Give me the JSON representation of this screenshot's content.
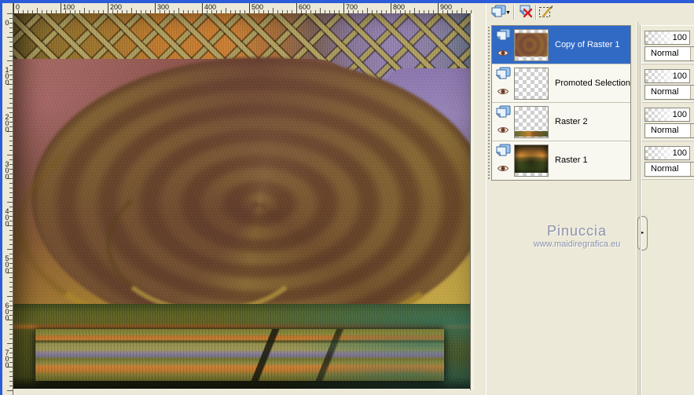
{
  "app": {
    "panel_bg": "#ece9d8",
    "window_edge_color": "#2b5cd9",
    "selection_color": "#316ac5"
  },
  "rulers": {
    "horizontal": [
      "0",
      "100",
      "200",
      "300",
      "400",
      "500",
      "600",
      "700",
      "800",
      "900"
    ],
    "vertical": [
      "0",
      "100",
      "200",
      "300",
      "400",
      "500",
      "600",
      "700"
    ]
  },
  "layers_toolbar": {
    "new_layer_arrow": "▼",
    "buttons": [
      {
        "icon": "new-layer-icon"
      },
      {
        "icon": "delete-layer-icon"
      },
      {
        "icon": "edit-selection-icon"
      }
    ]
  },
  "layers": [
    {
      "name": "Copy of Raster 1",
      "selected": true,
      "opacity": "100",
      "blend_mode": "Normal",
      "thumbnail": "swirl-artwork"
    },
    {
      "name": "Promoted Selection",
      "selected": false,
      "opacity": "100",
      "blend_mode": "Normal",
      "thumbnail": "transparent"
    },
    {
      "name": "Raster 2",
      "selected": false,
      "opacity": "100",
      "blend_mode": "Normal",
      "thumbnail": "transparent-with-landscape-strip"
    },
    {
      "name": "Raster 1",
      "selected": false,
      "opacity": "100",
      "blend_mode": "Normal",
      "thumbnail": "landscape"
    }
  ],
  "panel_handle": {
    "arrow": "►"
  },
  "combo_arrow": "▾",
  "watermark": {
    "name": "Pinuccia",
    "site": "www.maidiregrafica.eu"
  },
  "canvas_art": {
    "description": "twirled drape artwork over lattice top band and striped field bottom band",
    "palette": [
      "#c97f2f",
      "#9b88b9",
      "#7a4a3c",
      "#caa93e",
      "#6d4b28",
      "#5d6322",
      "#c0752b",
      "#2e6b5a"
    ]
  }
}
